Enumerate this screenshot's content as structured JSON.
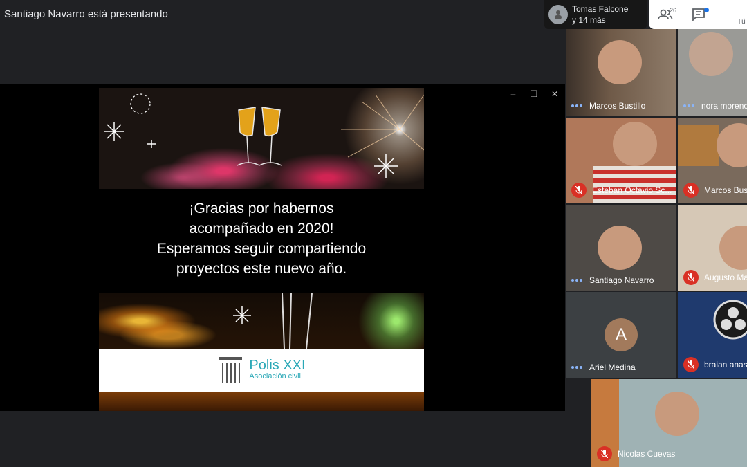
{
  "presenter_text": "Santiago Navarro está presentando",
  "chat_head": {
    "line1": "Tomas Falcone",
    "line2": "y 14 más"
  },
  "toolbar": {
    "participants_count": "26",
    "cut_label": "Tú"
  },
  "slide": {
    "message_lines": [
      "¡Gracias por habernos",
      "acompañado en 2020!",
      "Esperamos seguir compartiendo",
      "proyectos este nuevo año."
    ],
    "logo_name": "Polis XXI",
    "logo_sub": "Asociación civil"
  },
  "participants": [
    {
      "name": "Marcos Bustillo",
      "muted": false
    },
    {
      "name": "nora moreno",
      "muted": false
    },
    {
      "name": "Esteban Octavio Sc...",
      "muted": true
    },
    {
      "name": "Marcos Bus",
      "muted": true
    },
    {
      "name": "Santiago Navarro",
      "muted": false
    },
    {
      "name": "Augusto Ma",
      "muted": true
    },
    {
      "name": "Ariel Medina",
      "muted": false,
      "initial": "A"
    },
    {
      "name": "braian anas",
      "muted": true
    },
    {
      "name": "Nicolas Cuevas",
      "muted": true
    }
  ],
  "colors": {
    "mute": "#d93025",
    "speaking_dots": "#8ab4f8",
    "logo": "#2aa8b7",
    "meet_bg": "#202124"
  }
}
